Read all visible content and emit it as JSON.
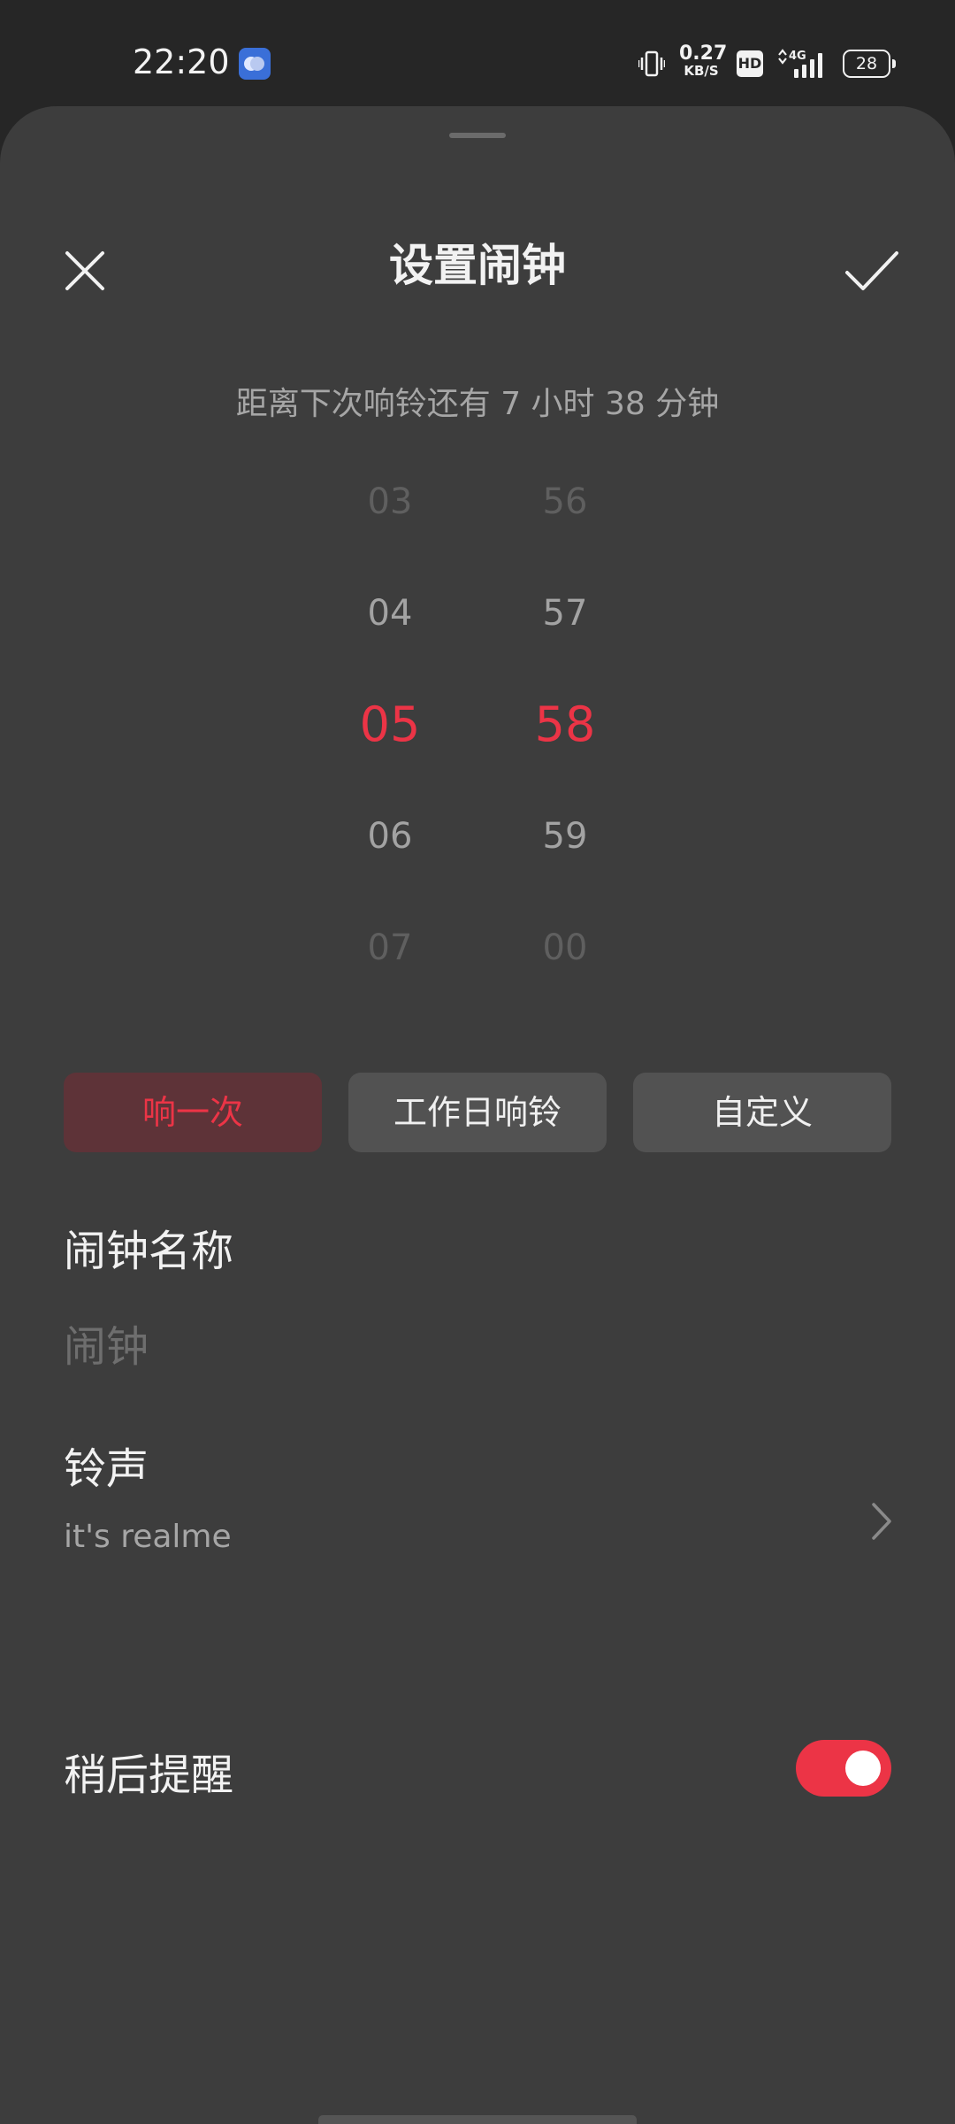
{
  "status_bar": {
    "time": "22:20",
    "app_notification_icon": "cloud-app-icon",
    "vibrate_icon": "vibrate-icon",
    "net_speed_value": "0.27",
    "net_speed_unit": "KB/S",
    "hd_label": "HD",
    "network_label": "4G",
    "battery_level": "28"
  },
  "dialog": {
    "title": "设置闹钟",
    "close_icon": "close-icon",
    "confirm_icon": "check-icon",
    "countdown": "距离下次响铃还有  7 小时 38 分钟"
  },
  "time_picker": {
    "hours": [
      "03",
      "04",
      "05",
      "06",
      "07"
    ],
    "minutes": [
      "56",
      "57",
      "58",
      "59",
      "00"
    ],
    "selected_hour": "05",
    "selected_minute": "58"
  },
  "repeat_options": [
    {
      "label": "响一次",
      "active": true
    },
    {
      "label": "工作日响铃",
      "active": false
    },
    {
      "label": "自定义",
      "active": false
    }
  ],
  "alarm_name": {
    "label": "闹钟名称",
    "placeholder": "闹钟",
    "value": ""
  },
  "ringtone": {
    "label": "铃声",
    "value": "it's realme"
  },
  "snooze": {
    "label": "稍后提醒",
    "enabled": true
  },
  "colors": {
    "accent": "#ec3446",
    "sheet_bg": "#3d3d3d",
    "status_bg": "#262626"
  }
}
